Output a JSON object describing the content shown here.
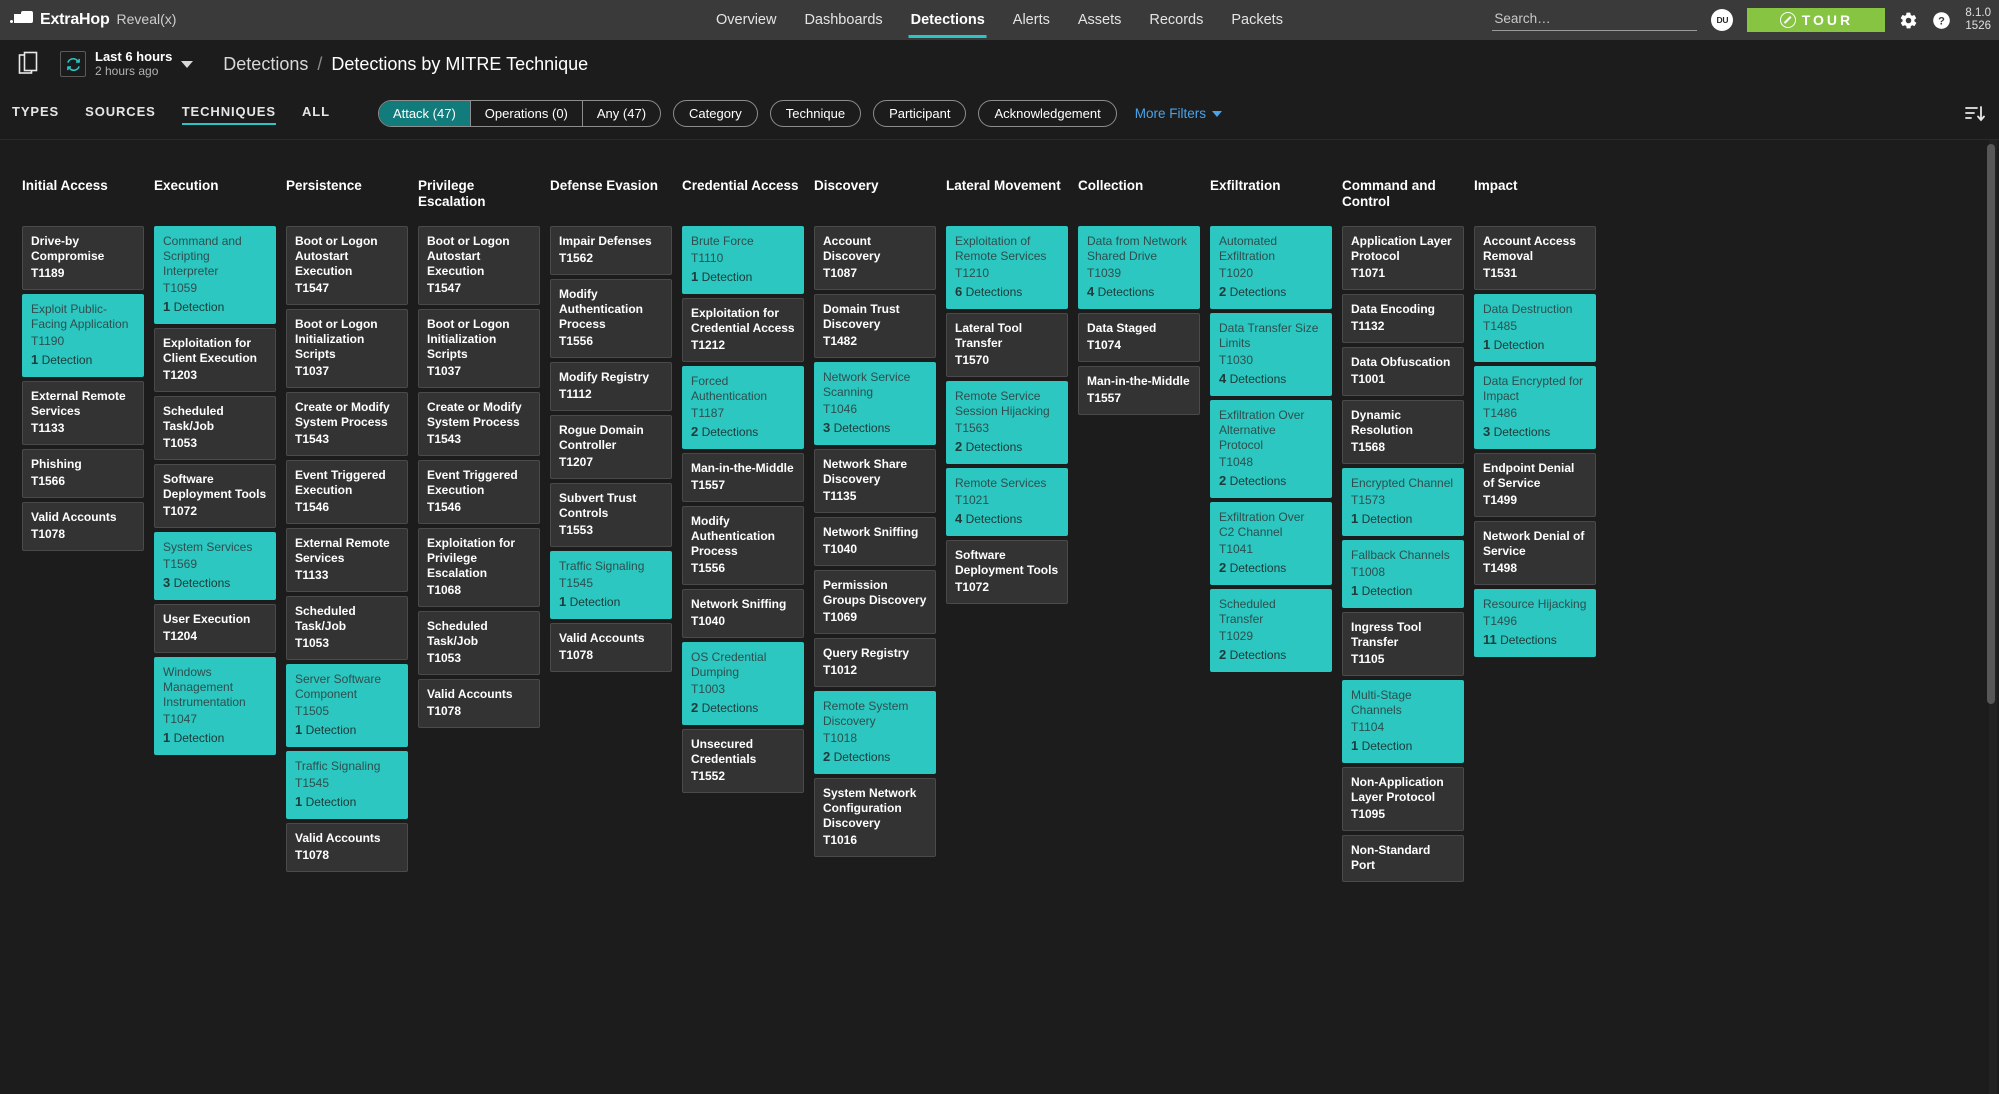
{
  "topnav": {
    "brand_name": "ExtraHop",
    "brand_product": "Reveal(x)",
    "menu": [
      {
        "label": "Overview",
        "active": false
      },
      {
        "label": "Dashboards",
        "active": false
      },
      {
        "label": "Detections",
        "active": true
      },
      {
        "label": "Alerts",
        "active": false
      },
      {
        "label": "Assets",
        "active": false
      },
      {
        "label": "Records",
        "active": false
      },
      {
        "label": "Packets",
        "active": false
      }
    ],
    "search_placeholder": "Search…",
    "avatar_initials": "DU",
    "tour_label": "TOUR",
    "version_line1": "8.1.0",
    "version_line2": "1526"
  },
  "subheader": {
    "time_primary": "Last 6 hours",
    "time_secondary": "2 hours ago",
    "crumb_parent": "Detections",
    "crumb_sep": "/",
    "crumb_current": "Detections by MITRE Technique"
  },
  "filterbar": {
    "tabs": [
      {
        "label": "TYPES",
        "active": false
      },
      {
        "label": "SOURCES",
        "active": false
      },
      {
        "label": "TECHNIQUES",
        "active": true
      },
      {
        "label": "ALL",
        "active": false
      }
    ],
    "segments": [
      {
        "label": "Attack (47)",
        "active": true
      },
      {
        "label": "Operations (0)",
        "active": false
      },
      {
        "label": "Any (47)",
        "active": false
      }
    ],
    "pills": [
      "Category",
      "Technique",
      "Participant",
      "Acknowledgement"
    ],
    "more_filters": "More Filters"
  },
  "accent_color": "#2bc7c0",
  "matrix": {
    "columns": [
      {
        "header": "Initial Access",
        "cards": [
          {
            "name": "Drive-by Compromise",
            "id": "T1189",
            "detections": null
          },
          {
            "name": "Exploit Public-Facing Application",
            "id": "T1190",
            "detections": "1 Detection"
          },
          {
            "name": "External Remote Services",
            "id": "T1133",
            "detections": null
          },
          {
            "name": "Phishing",
            "id": "T1566",
            "detections": null
          },
          {
            "name": "Valid Accounts",
            "id": "T1078",
            "detections": null
          }
        ]
      },
      {
        "header": "Execution",
        "cards": [
          {
            "name": "Command and Scripting Interpreter",
            "id": "T1059",
            "detections": "1 Detection"
          },
          {
            "name": "Exploitation for Client Execution",
            "id": "T1203",
            "detections": null
          },
          {
            "name": "Scheduled Task/Job",
            "id": "T1053",
            "detections": null
          },
          {
            "name": "Software Deployment Tools",
            "id": "T1072",
            "detections": null
          },
          {
            "name": "System Services",
            "id": "T1569",
            "detections": "3 Detections"
          },
          {
            "name": "User Execution",
            "id": "T1204",
            "detections": null
          },
          {
            "name": "Windows Management Instrumentation",
            "id": "T1047",
            "detections": "1 Detection"
          }
        ]
      },
      {
        "header": "Persistence",
        "cards": [
          {
            "name": "Boot or Logon Autostart Execution",
            "id": "T1547",
            "detections": null
          },
          {
            "name": "Boot or Logon Initialization Scripts",
            "id": "T1037",
            "detections": null
          },
          {
            "name": "Create or Modify System Process",
            "id": "T1543",
            "detections": null
          },
          {
            "name": "Event Triggered Execution",
            "id": "T1546",
            "detections": null
          },
          {
            "name": "External Remote Services",
            "id": "T1133",
            "detections": null
          },
          {
            "name": "Scheduled Task/Job",
            "id": "T1053",
            "detections": null
          },
          {
            "name": "Server Software Component",
            "id": "T1505",
            "detections": "1 Detection"
          },
          {
            "name": "Traffic Signaling",
            "id": "T1545",
            "detections": "1 Detection"
          },
          {
            "name": "Valid Accounts",
            "id": "T1078",
            "detections": null
          }
        ]
      },
      {
        "header": "Privilege Escalation",
        "cards": [
          {
            "name": "Boot or Logon Autostart Execution",
            "id": "T1547",
            "detections": null
          },
          {
            "name": "Boot or Logon Initialization Scripts",
            "id": "T1037",
            "detections": null
          },
          {
            "name": "Create or Modify System Process",
            "id": "T1543",
            "detections": null
          },
          {
            "name": "Event Triggered Execution",
            "id": "T1546",
            "detections": null
          },
          {
            "name": "Exploitation for Privilege Escalation",
            "id": "T1068",
            "detections": null
          },
          {
            "name": "Scheduled Task/Job",
            "id": "T1053",
            "detections": null
          },
          {
            "name": "Valid Accounts",
            "id": "T1078",
            "detections": null
          }
        ]
      },
      {
        "header": "Defense Evasion",
        "cards": [
          {
            "name": "Impair Defenses",
            "id": "T1562",
            "detections": null
          },
          {
            "name": "Modify Authentication Process",
            "id": "T1556",
            "detections": null
          },
          {
            "name": "Modify Registry",
            "id": "T1112",
            "detections": null
          },
          {
            "name": "Rogue Domain Controller",
            "id": "T1207",
            "detections": null
          },
          {
            "name": "Subvert Trust Controls",
            "id": "T1553",
            "detections": null
          },
          {
            "name": "Traffic Signaling",
            "id": "T1545",
            "detections": "1 Detection"
          },
          {
            "name": "Valid Accounts",
            "id": "T1078",
            "detections": null
          }
        ]
      },
      {
        "header": "Credential Access",
        "cards": [
          {
            "name": "Brute Force",
            "id": "T1110",
            "detections": "1 Detection"
          },
          {
            "name": "Exploitation for Credential Access",
            "id": "T1212",
            "detections": null
          },
          {
            "name": "Forced Authentication",
            "id": "T1187",
            "detections": "2 Detections"
          },
          {
            "name": "Man-in-the-Middle",
            "id": "T1557",
            "detections": null
          },
          {
            "name": "Modify Authentication Process",
            "id": "T1556",
            "detections": null
          },
          {
            "name": "Network Sniffing",
            "id": "T1040",
            "detections": null
          },
          {
            "name": "OS Credential Dumping",
            "id": "T1003",
            "detections": "2 Detections"
          },
          {
            "name": "Unsecured Credentials",
            "id": "T1552",
            "detections": null
          }
        ]
      },
      {
        "header": "Discovery",
        "cards": [
          {
            "name": "Account Discovery",
            "id": "T1087",
            "detections": null
          },
          {
            "name": "Domain Trust Discovery",
            "id": "T1482",
            "detections": null
          },
          {
            "name": "Network Service Scanning",
            "id": "T1046",
            "detections": "3 Detections"
          },
          {
            "name": "Network Share Discovery",
            "id": "T1135",
            "detections": null
          },
          {
            "name": "Network Sniffing",
            "id": "T1040",
            "detections": null
          },
          {
            "name": "Permission Groups Discovery",
            "id": "T1069",
            "detections": null
          },
          {
            "name": "Query Registry",
            "id": "T1012",
            "detections": null
          },
          {
            "name": "Remote System Discovery",
            "id": "T1018",
            "detections": "2 Detections"
          },
          {
            "name": "System Network Configuration Discovery",
            "id": "T1016",
            "detections": null
          }
        ]
      },
      {
        "header": "Lateral Movement",
        "cards": [
          {
            "name": "Exploitation of Remote Services",
            "id": "T1210",
            "detections": "6 Detections"
          },
          {
            "name": "Lateral Tool Transfer",
            "id": "T1570",
            "detections": null
          },
          {
            "name": "Remote Service Session Hijacking",
            "id": "T1563",
            "detections": "2 Detections"
          },
          {
            "name": "Remote Services",
            "id": "T1021",
            "detections": "4 Detections"
          },
          {
            "name": "Software Deployment Tools",
            "id": "T1072",
            "detections": null
          }
        ]
      },
      {
        "header": "Collection",
        "cards": [
          {
            "name": "Data from Network Shared Drive",
            "id": "T1039",
            "detections": "4 Detections"
          },
          {
            "name": "Data Staged",
            "id": "T1074",
            "detections": null
          },
          {
            "name": "Man-in-the-Middle",
            "id": "T1557",
            "detections": null
          }
        ]
      },
      {
        "header": "Exfiltration",
        "cards": [
          {
            "name": "Automated Exfiltration",
            "id": "T1020",
            "detections": "2 Detections"
          },
          {
            "name": "Data Transfer Size Limits",
            "id": "T1030",
            "detections": "4 Detections"
          },
          {
            "name": "Exfiltration Over Alternative Protocol",
            "id": "T1048",
            "detections": "2 Detections"
          },
          {
            "name": "Exfiltration Over C2 Channel",
            "id": "T1041",
            "detections": "2 Detections"
          },
          {
            "name": "Scheduled Transfer",
            "id": "T1029",
            "detections": "2 Detections"
          }
        ]
      },
      {
        "header": "Command and Control",
        "cards": [
          {
            "name": "Application Layer Protocol",
            "id": "T1071",
            "detections": null
          },
          {
            "name": "Data Encoding",
            "id": "T1132",
            "detections": null
          },
          {
            "name": "Data Obfuscation",
            "id": "T1001",
            "detections": null
          },
          {
            "name": "Dynamic Resolution",
            "id": "T1568",
            "detections": null
          },
          {
            "name": "Encrypted Channel",
            "id": "T1573",
            "detections": "1 Detection"
          },
          {
            "name": "Fallback Channels",
            "id": "T1008",
            "detections": "1 Detection"
          },
          {
            "name": "Ingress Tool Transfer",
            "id": "T1105",
            "detections": null
          },
          {
            "name": "Multi-Stage Channels",
            "id": "T1104",
            "detections": "1 Detection"
          },
          {
            "name": "Non-Application Layer Protocol",
            "id": "T1095",
            "detections": null
          },
          {
            "name": "Non-Standard Port",
            "id": "",
            "detections": null
          }
        ]
      },
      {
        "header": "Impact",
        "cards": [
          {
            "name": "Account Access Removal",
            "id": "T1531",
            "detections": null
          },
          {
            "name": "Data Destruction",
            "id": "T1485",
            "detections": "1 Detection"
          },
          {
            "name": "Data Encrypted for Impact",
            "id": "T1486",
            "detections": "3 Detections"
          },
          {
            "name": "Endpoint Denial of Service",
            "id": "T1499",
            "detections": null
          },
          {
            "name": "Network Denial of Service",
            "id": "T1498",
            "detections": null
          },
          {
            "name": "Resource Hijacking",
            "id": "T1496",
            "detections": "11 Detections"
          }
        ]
      }
    ]
  }
}
